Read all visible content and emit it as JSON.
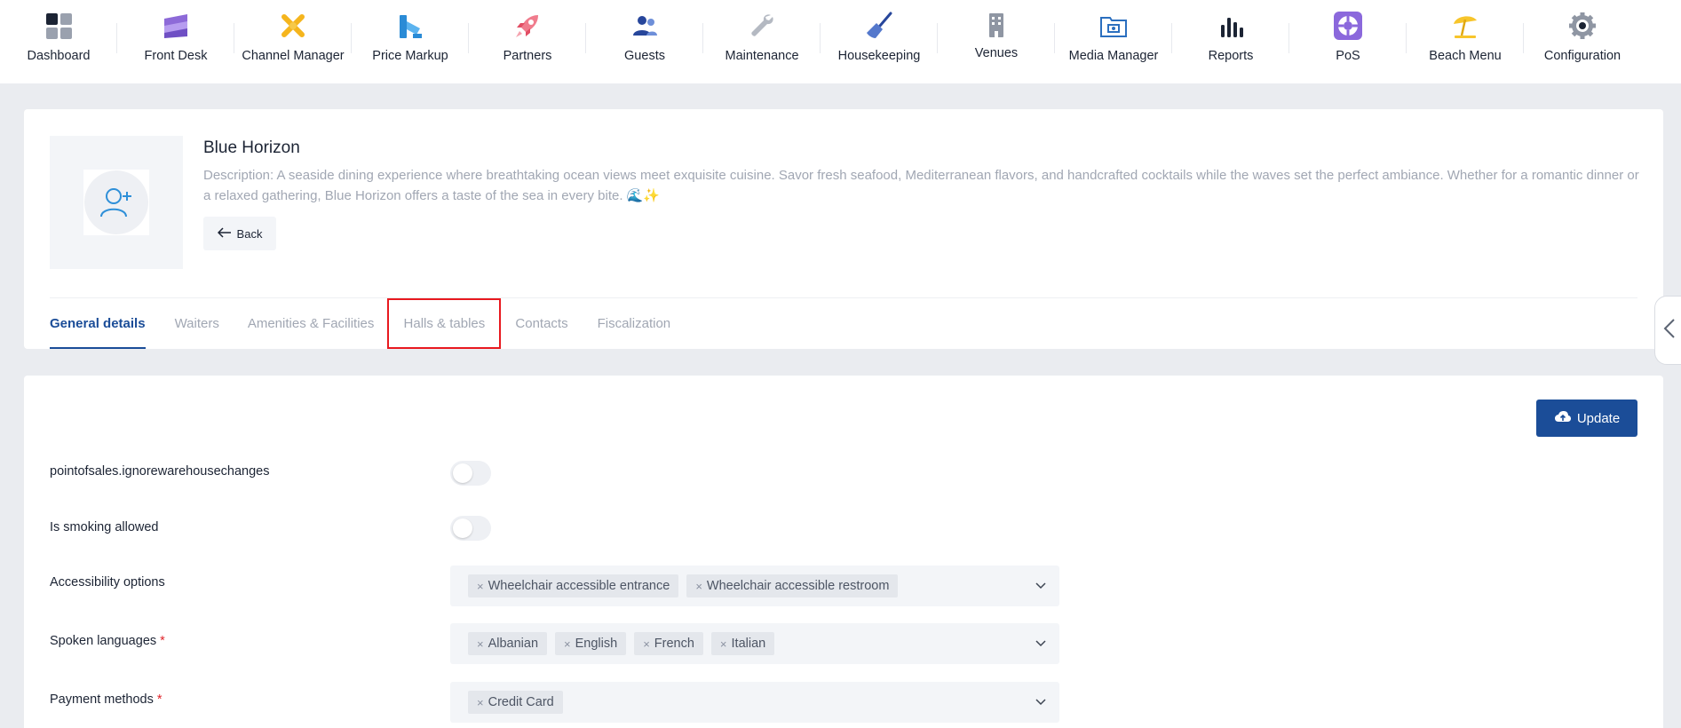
{
  "nav": {
    "items": [
      {
        "label": "Dashboard",
        "icon": "dashboard-icon"
      },
      {
        "label": "Front Desk",
        "icon": "layers-icon"
      },
      {
        "label": "Channel Manager",
        "icon": "channels-icon"
      },
      {
        "label": "Price Markup",
        "icon": "price-markup-icon"
      },
      {
        "label": "Partners",
        "icon": "rocket-icon"
      },
      {
        "label": "Guests",
        "icon": "guests-icon"
      },
      {
        "label": "Maintenance",
        "icon": "wrench-icon"
      },
      {
        "label": "Housekeeping",
        "icon": "broom-icon"
      },
      {
        "label": "Venues",
        "icon": "building-icon"
      },
      {
        "label": "Media Manager",
        "icon": "media-folder-icon"
      },
      {
        "label": "Reports",
        "icon": "bar-chart-icon"
      },
      {
        "label": "PoS",
        "icon": "lifebuoy-icon"
      },
      {
        "label": "Beach Menu",
        "icon": "beach-umbrella-icon"
      },
      {
        "label": "Configuration",
        "icon": "gear-icon"
      }
    ]
  },
  "venue": {
    "title": "Blue Horizon",
    "description": "Description: A seaside dining experience where breathtaking ocean views meet exquisite cuisine. Savor fresh seafood, Mediterranean flavors, and handcrafted cocktails while the waves set the perfect ambiance. Whether for a romantic dinner or a relaxed gathering, Blue Horizon offers a taste of the sea in every bite. 🌊✨",
    "back_label": "Back"
  },
  "tabs": [
    {
      "label": "General details",
      "active": true
    },
    {
      "label": "Waiters"
    },
    {
      "label": "Amenities & Facilities"
    },
    {
      "label": "Halls & tables",
      "highlighted": true
    },
    {
      "label": "Contacts"
    },
    {
      "label": "Fiscalization"
    }
  ],
  "form": {
    "update_label": "Update",
    "ignore_warehouse_label": "pointofsales.ignorewarehousechanges",
    "smoking_label": "Is smoking allowed",
    "accessibility_label": "Accessibility options",
    "accessibility_values": [
      "Wheelchair accessible entrance",
      "Wheelchair accessible restroom"
    ],
    "languages_label": "Spoken languages",
    "languages_values": [
      "Albanian",
      "English",
      "French",
      "Italian"
    ],
    "payment_label": "Payment methods",
    "payment_values": [
      "Credit Card"
    ],
    "required_mark": "*",
    "chip_remove": "×"
  },
  "colors": {
    "primary": "#1b4d98",
    "required": "#e0252b",
    "highlight": "#e8191f"
  }
}
